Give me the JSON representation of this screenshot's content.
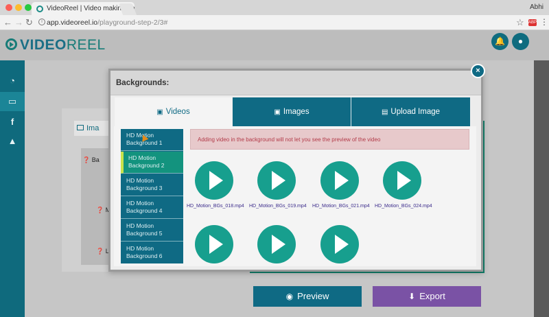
{
  "browser": {
    "tab_title": "VideoReel | Video making app",
    "tab_close": "×",
    "user": "Abhi",
    "url_host": "app.videoreel.io",
    "url_path": "/playground-step-2/3#",
    "ext_label": "ABP"
  },
  "header": {
    "logo_left": "VIDEO",
    "logo_right": "REEL",
    "bell_icon": "🔔",
    "user_icon": "●"
  },
  "sidebar": {
    "items": [
      {
        "icon": "◔",
        "name": "dashboard"
      },
      {
        "icon": "▭",
        "name": "laptop"
      },
      {
        "icon": "f",
        "name": "facebook"
      },
      {
        "icon": "▲",
        "name": "graduation"
      }
    ]
  },
  "page": {
    "bg_tab_label": "Ima",
    "bg_rows": [
      "❓ Ba",
      "❓ M",
      "❓ L"
    ],
    "preview_label": "Preview",
    "export_label": "Export"
  },
  "modal": {
    "title": "Backgrounds:",
    "close": "×",
    "tabs": [
      {
        "label": "Videos",
        "active": true
      },
      {
        "label": "Images",
        "active": false
      },
      {
        "label": "Upload Image",
        "active": false
      }
    ],
    "alert": "Adding video in the background will not let you see the preview of the video",
    "backgrounds": [
      {
        "line1": "HD Motion",
        "line2": "Background 1",
        "active": false
      },
      {
        "line1": "HD Motion",
        "line2": "Background 2",
        "active": true
      },
      {
        "line1": "HD Motion",
        "line2": "Background 3",
        "active": false
      },
      {
        "line1": "HD Motion",
        "line2": "Background 4",
        "active": false
      },
      {
        "line1": "HD Motion",
        "line2": "Background 5",
        "active": false
      },
      {
        "line1": "HD Motion",
        "line2": "Background 6",
        "active": false
      }
    ],
    "videos": [
      {
        "label": "HD_Motion_BGs_018.mp4"
      },
      {
        "label": "HD_Motion_BGs_019.mp4"
      },
      {
        "label": "HD_Motion_BGs_021.mp4"
      },
      {
        "label": "HD_Motion_BGs_024.mp4"
      },
      {
        "label": ""
      },
      {
        "label": ""
      },
      {
        "label": ""
      }
    ]
  },
  "colors": {
    "brand_teal": "#0f6a84",
    "play_green": "#179f8e",
    "export_purple": "#7a52a5",
    "alert_bg": "#e7c9cb"
  }
}
